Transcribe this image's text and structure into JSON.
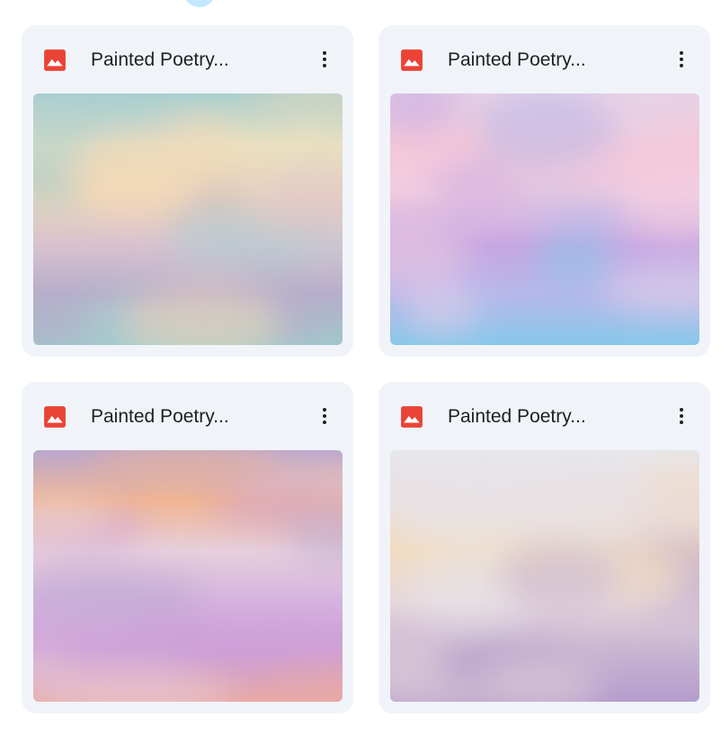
{
  "files": [
    {
      "title": "Painted Poetry...",
      "icon": "image-file-icon",
      "icon_color": "#ea4335",
      "menu_icon": "more-vert-icon",
      "palette": [
        "#a8cfd0",
        "#e8e0c0",
        "#f2d8b8",
        "#d9c2cf",
        "#b7aecb",
        "#9fc9cc"
      ]
    },
    {
      "title": "Painted Poetry...",
      "icon": "image-file-icon",
      "icon_color": "#ea4335",
      "menu_icon": "more-vert-icon",
      "palette": [
        "#e8d2e6",
        "#f4c8d8",
        "#f1cde0",
        "#c7a6e2",
        "#b6b8ea",
        "#86c8ea"
      ]
    },
    {
      "title": "Painted Poetry...",
      "icon": "image-file-icon",
      "icon_color": "#ea4335",
      "menu_icon": "more-vert-icon",
      "palette": [
        "#b9a7cf",
        "#f0b592",
        "#e7cfdc",
        "#d6b3df",
        "#cc9fd6",
        "#e9a9a4"
      ]
    },
    {
      "title": "Painted Poetry...",
      "icon": "image-file-icon",
      "icon_color": "#ea4335",
      "menu_icon": "more-vert-icon",
      "palette": [
        "#e7e7ec",
        "#e9dee0",
        "#f2dcc0",
        "#e6d6da",
        "#c7b5d2",
        "#b59ccc"
      ]
    }
  ]
}
